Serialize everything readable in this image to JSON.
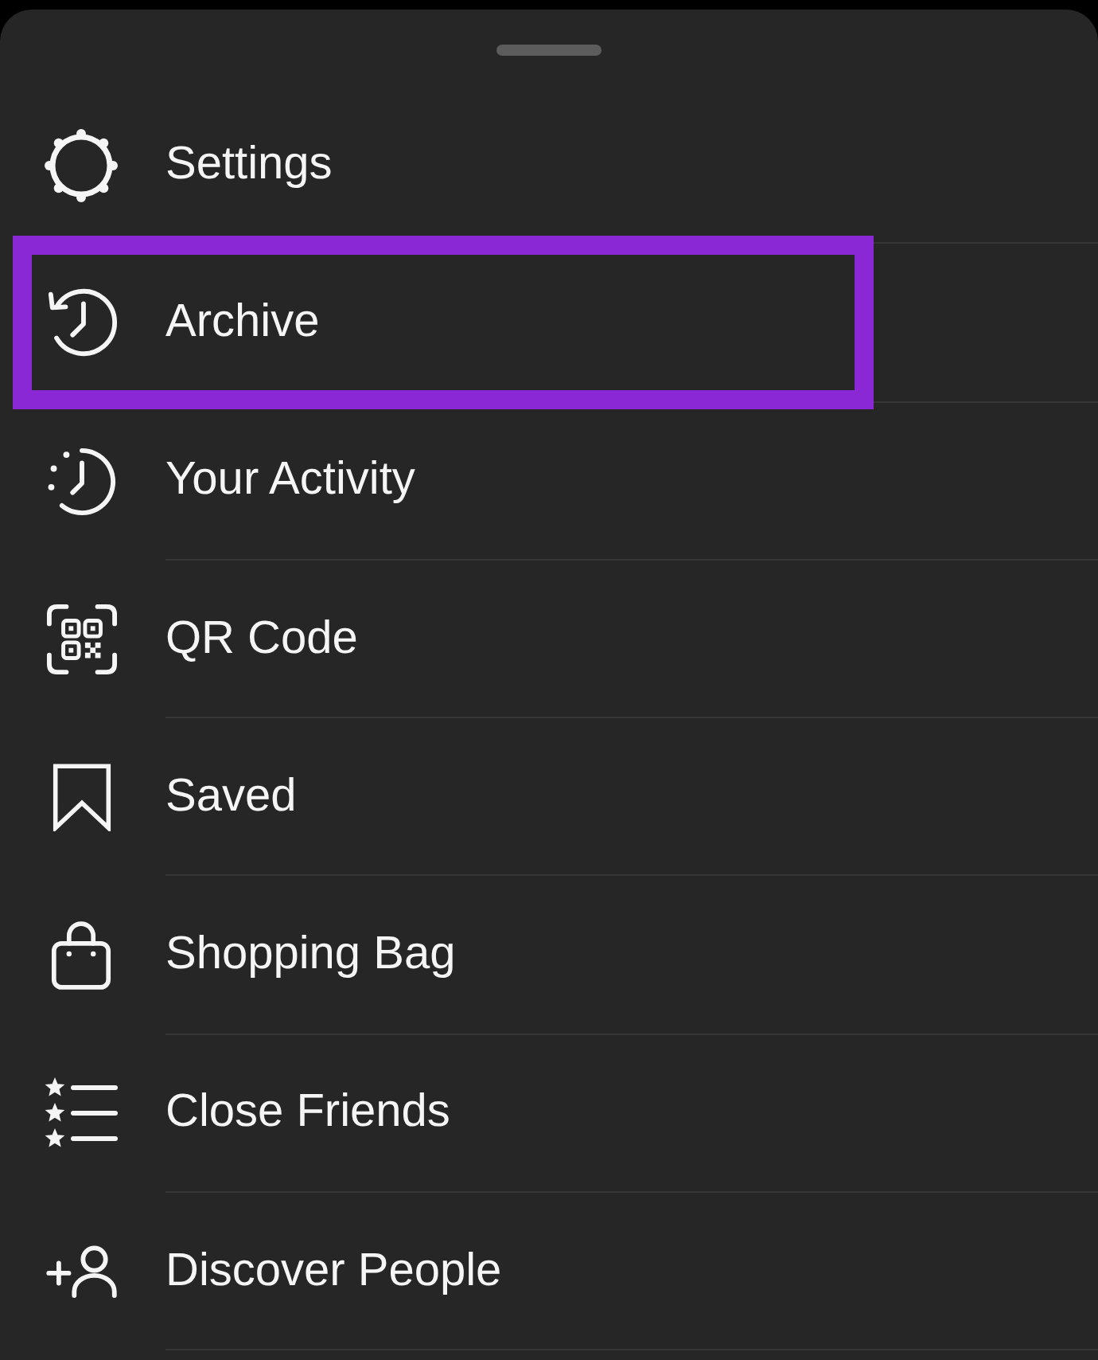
{
  "menu": {
    "items": [
      {
        "label": "Settings",
        "highlighted": false
      },
      {
        "label": "Archive",
        "highlighted": true
      },
      {
        "label": "Your Activity",
        "highlighted": false
      },
      {
        "label": "QR Code",
        "highlighted": false
      },
      {
        "label": "Saved",
        "highlighted": false
      },
      {
        "label": "Shopping Bag",
        "highlighted": false
      },
      {
        "label": "Close Friends",
        "highlighted": false
      },
      {
        "label": "Discover People",
        "highlighted": false
      }
    ]
  }
}
